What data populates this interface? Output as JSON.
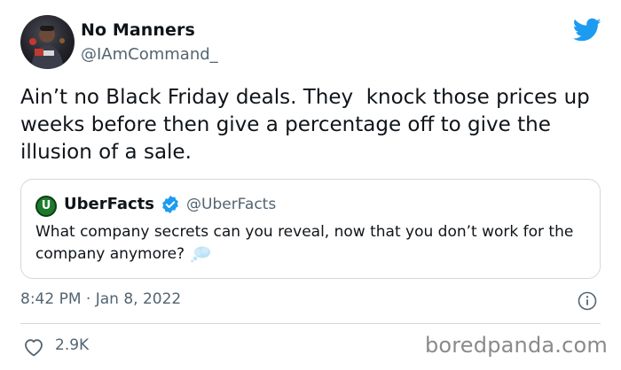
{
  "tweet": {
    "display_name": "No Manners",
    "handle": "@IAmCommand_",
    "text": "Ain’t no Black Friday deals. They  knock those prices up weeks before then give a percentage off to give the illusion of a sale.",
    "timestamp": "8:42 PM · Jan 8, 2022",
    "like_count": "2.9K"
  },
  "quoted_tweet": {
    "avatar_letter": "U",
    "display_name": "UberFacts",
    "handle": "@UberFacts",
    "text": "What company secrets can you reveal, now that you don’t work for the company anymore?"
  },
  "icons": {
    "brand": "twitter-bird-icon",
    "verified": "verified-badge-icon",
    "emoji": "thought-bubble-icon",
    "info": "info-icon",
    "like": "heart-icon"
  },
  "colors": {
    "twitter_blue": "#1d9bf0",
    "text_primary": "#0f1419",
    "text_secondary": "#536471",
    "border": "#cfd9de"
  },
  "watermark": "boredpanda.com"
}
